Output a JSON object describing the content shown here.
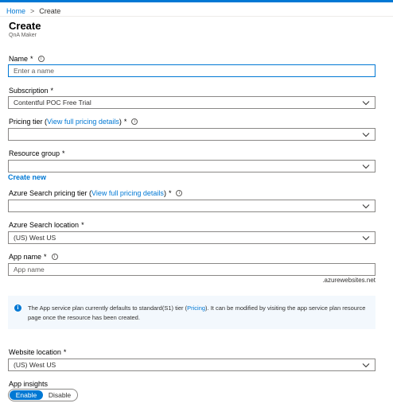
{
  "breadcrumb": {
    "home": "Home",
    "separator": ">",
    "current": "Create"
  },
  "header": {
    "title": "Create",
    "subtitle": "QnA Maker"
  },
  "form": {
    "name": {
      "label": "Name",
      "required": "*",
      "placeholder": "Enter a name"
    },
    "subscription": {
      "label": "Subscription",
      "required": "*",
      "value": "Contentful POC Free Trial"
    },
    "pricing_tier": {
      "label_prefix": "Pricing tier (",
      "link": "View full pricing details",
      "label_suffix": ")",
      "required": "*",
      "value": ""
    },
    "resource_group": {
      "label": "Resource group",
      "required": "*",
      "value": "",
      "create_new": "Create new"
    },
    "search_tier": {
      "label_prefix": "Azure Search pricing tier (",
      "link": "View full pricing details",
      "label_suffix": ")",
      "required": "*",
      "value": ""
    },
    "search_location": {
      "label": "Azure Search location",
      "required": "*",
      "value": "(US) West US"
    },
    "app_name": {
      "label": "App name",
      "required": "*",
      "placeholder": "App name",
      "suffix": ".azurewebsites.net"
    },
    "info": {
      "text_before": "The App service plan currently defaults to standard(S1) tier (",
      "link": "Pricing",
      "text_after": "). It can be modified by visiting the app service plan resource page once the resource has been created."
    },
    "website_location": {
      "label": "Website location",
      "required": "*",
      "value": "(US) West US"
    },
    "app_insights": {
      "label": "App insights",
      "options": [
        "Enable",
        "Disable"
      ],
      "selected": "Enable"
    }
  },
  "colors": {
    "accent": "#0078d4",
    "info_bg": "#f3f8fd",
    "border": "#8a8886"
  },
  "icons": {
    "info": "info-icon",
    "chevron": "chevron-down-icon",
    "breadcrumb_sep": "chevron-right-icon"
  }
}
